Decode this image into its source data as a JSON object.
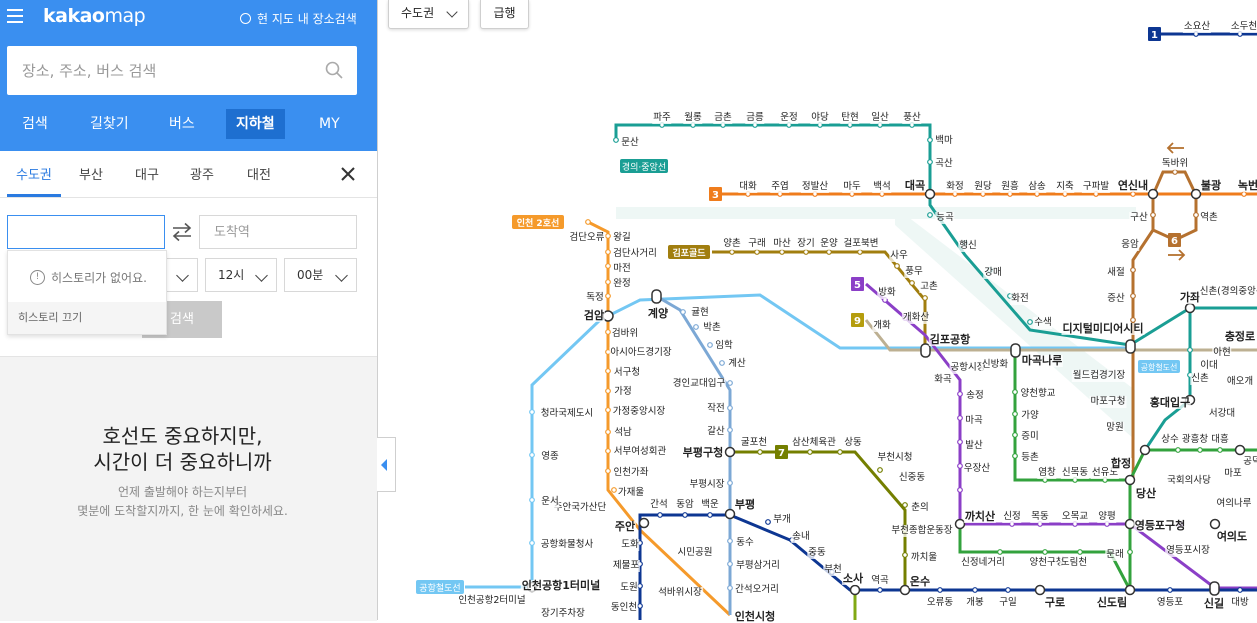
{
  "header": {
    "logo_bold": "kakao",
    "logo_thin": "map",
    "radio_label": "현 지도 내 장소검색"
  },
  "search": {
    "placeholder": "장소, 주소, 버스 검색"
  },
  "nav": {
    "items": [
      "검색",
      "길찾기",
      "버스",
      "지하철",
      "MY"
    ],
    "active": "지하철"
  },
  "region_tabs": [
    "수도권",
    "부산",
    "대구",
    "광주",
    "대전"
  ],
  "route": {
    "start_value": "",
    "dest_placeholder": "도착역",
    "hour": "12시",
    "minute": "00분",
    "search_label": "검색"
  },
  "history": {
    "empty_text": "히스토리가 없어요.",
    "off_label": "히스토리 끄기"
  },
  "promo": {
    "title_line1": "호선도 중요하지만,",
    "title_line2": "시간이 더 중요하니까",
    "sub_line1": "언제 출발해야 하는지부터",
    "sub_line2": "몇분에 도착할지까지, 한 눈에 확인하세요."
  },
  "map_controls": {
    "region": "수도권",
    "express": "급행"
  },
  "colors": {
    "brand_blue": "#3a8ff0",
    "line1": "#0d3692",
    "line2_incheon": "#f5a200",
    "line3": "#ef7c1c",
    "line5": "#8b3fc7",
    "line6": "#cd7c2f",
    "line7": "#747f00",
    "line9": "#bdb092",
    "gyeongui": "#77c4a3",
    "airport": "#73c7f3",
    "gimpo_gold": "#a17e0f",
    "incheon1": "#7ca8d5",
    "seohae": "#81a914"
  },
  "map_labels": {
    "line_badges": [
      "1",
      "3",
      "5",
      "6",
      "7",
      "9"
    ],
    "line_names": [
      "경의·중앙선",
      "인천 2호선",
      "김포골드",
      "공항철도선",
      "공항철도선"
    ],
    "stations": [
      "소요산",
      "소두천",
      "파주",
      "월롱",
      "금촌",
      "금릉",
      "운정",
      "야당",
      "탄현",
      "일산",
      "풍산",
      "백마",
      "곡산",
      "문산",
      "대화",
      "주엽",
      "정발산",
      "마두",
      "백석",
      "대곡",
      "화정",
      "원당",
      "원흥",
      "삼송",
      "지축",
      "구파발",
      "연신내",
      "불광",
      "녹번",
      "독바위",
      "구산",
      "역촌",
      "응암",
      "새절",
      "증산",
      "능곡",
      "행신",
      "강매",
      "화전",
      "수색",
      "디지털미디어시티",
      "가좌",
      "신촌(경의중앙선)",
      "검단오류",
      "왕길",
      "검단사거리",
      "마전",
      "완정",
      "독정",
      "검암",
      "계양",
      "귤현",
      "박촌",
      "임학",
      "계산",
      "양촌",
      "구래",
      "마산",
      "장기",
      "운양",
      "걸포북변",
      "사우",
      "풍무",
      "고촌",
      "방화",
      "개화산",
      "개화",
      "김포공항",
      "공항시장",
      "신방화",
      "마곡나루",
      "양천향교",
      "가양",
      "증미",
      "등촌",
      "염창",
      "신목동",
      "선유도",
      "당산",
      "합정",
      "홍대입구",
      "상수",
      "광흥창",
      "대흥",
      "서강대",
      "충정로",
      "아현",
      "이대",
      "신촌",
      "애오개",
      "월드컵경기장",
      "마포구청",
      "망원",
      "공덕",
      "국회의사당",
      "여의나루",
      "마포",
      "여의도",
      "영등포구청",
      "영등포시장",
      "신길",
      "대방",
      "검바위",
      "아시아드경기장",
      "서구청",
      "가정",
      "가정중앙시장",
      "석남",
      "서부여성회관",
      "인천가좌",
      "가재울",
      "주안국가산단",
      "경인교대입구",
      "작전",
      "갈산",
      "부평구청",
      "굴포천",
      "삼산체육관",
      "상동",
      "부천시청",
      "신중동",
      "춘의",
      "부천종합운동장",
      "까치울",
      "부평시장",
      "청라국제도시",
      "영종",
      "운서",
      "공항화물청사",
      "인천공항1터미널",
      "인천공항2터미널",
      "장기주차장",
      "간석",
      "동암",
      "백운",
      "부평",
      "주안",
      "도화",
      "제물포",
      "도원",
      "동인천",
      "시민공원",
      "석바위시장",
      "동수",
      "부평삼거리",
      "간석오거리",
      "인천시청",
      "부개",
      "송내",
      "중동",
      "부천",
      "소사",
      "역곡",
      "온수",
      "오류동",
      "개봉",
      "구일",
      "구로",
      "신도림",
      "문래",
      "영등포",
      "까치산",
      "신정",
      "목동",
      "오목교",
      "양평",
      "신정네거리",
      "양천구청",
      "도림천",
      "화곡",
      "우장산",
      "발산",
      "마곡",
      "송정"
    ]
  }
}
